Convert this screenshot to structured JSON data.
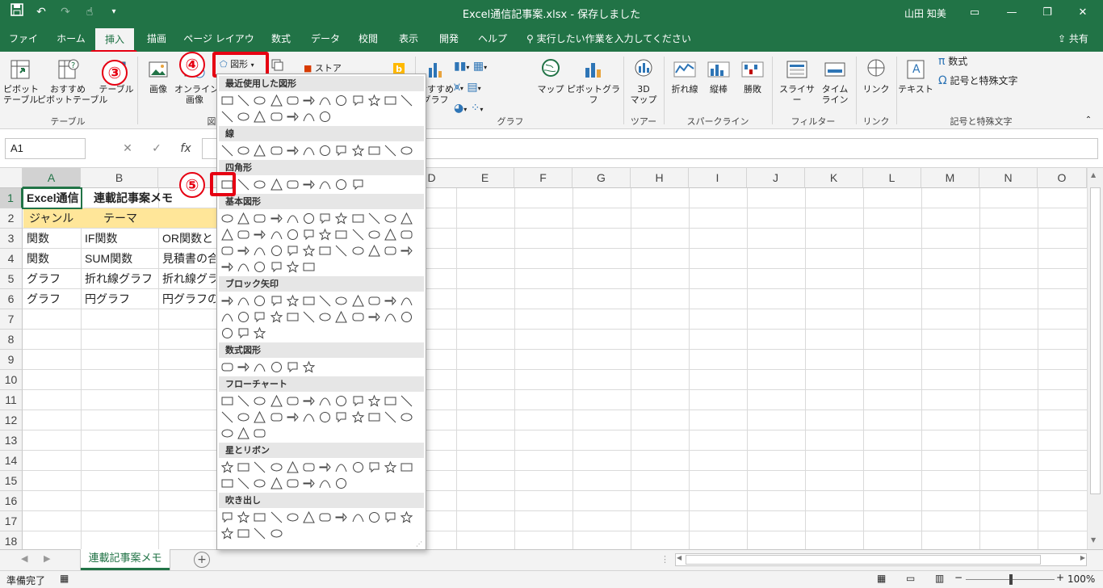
{
  "titlebar": {
    "title": "Excel通信記事案.xlsx  -  保存しました",
    "user": "山田 知美",
    "qat": {
      "save_icon": "floppy-disk-icon",
      "undo_icon": "undo-arrow-icon",
      "redo_icon": "redo-arrow-icon",
      "touch_icon": "hand-pointer-icon",
      "customize_icon": "chevron-down-icon"
    },
    "window_buttons": {
      "ribbon_display": "▭",
      "minimize": "—",
      "restore": "❐",
      "close": "✕"
    }
  },
  "tabs": [
    {
      "label": "ファイル"
    },
    {
      "label": "ホーム"
    },
    {
      "label": "挿入"
    },
    {
      "label": "描画"
    },
    {
      "label": "ページ レイアウト"
    },
    {
      "label": "数式"
    },
    {
      "label": "データ"
    },
    {
      "label": "校閲"
    },
    {
      "label": "表示"
    },
    {
      "label": "開発"
    },
    {
      "label": "ヘルプ"
    }
  ],
  "active_tab": "挿入",
  "tellme": "実行したい作業を入力してください",
  "share": "共有",
  "annotations": {
    "step3": "③",
    "step4": "④",
    "step5": "⑤"
  },
  "ribbon": {
    "pivot": "ピボット\nテーブル",
    "recommended_pivot": "おすすめ\nピボットテーブル",
    "table": "テーブル",
    "group_table": "テーブル",
    "picture": "画像",
    "online_picture": "オンライン\n画像",
    "group_illust": "図",
    "shapes_button": "図形",
    "store": "ストア",
    "recommended_chart": "おすすめ\nグラフ",
    "map": "マップ",
    "pivot_chart": "ピボットグラフ",
    "group_chart": "グラフ",
    "map3d": "3D\nマップ",
    "group_tour": "ツアー",
    "line": "折れ線",
    "column": "縦棒",
    "winloss": "勝敗",
    "group_sparkline": "スパークライン",
    "slicer": "スライサー",
    "timeline": "タイム\nライン",
    "group_filter": "フィルター",
    "link": "リンク",
    "group_link": "リンク",
    "text": "テキスト",
    "equation": "数式",
    "symbol": "記号と特殊文字",
    "group_symbol": "記号と特殊文字"
  },
  "formulabar": {
    "namebox": "A1",
    "cancel": "✕",
    "enter": "✓",
    "fx": "fx"
  },
  "grid": {
    "columns": [
      "A",
      "B",
      "C",
      "D",
      "E",
      "F",
      "G",
      "H",
      "I",
      "J",
      "K",
      "L",
      "M",
      "N",
      "O"
    ],
    "rows": [
      "1",
      "2",
      "3",
      "4",
      "5",
      "6",
      "7",
      "8",
      "9",
      "10",
      "11",
      "12",
      "13",
      "14",
      "15",
      "16",
      "17",
      "18"
    ],
    "cells": {
      "A1": "Excel通信",
      "B1": "連載記事案メモ",
      "A2": "ジャンル",
      "B2": "テーマ",
      "A3": "関数",
      "B3": "IF関数",
      "C3": "OR関数と",
      "A4": "関数",
      "B4": "SUM関数",
      "C4": "見積書の合",
      "A5": "グラフ",
      "B5": "折れ線グラフ",
      "C5": "折れ線グラ",
      "A6": "グラフ",
      "B6": "円グラフ",
      "C6": "円グラフの"
    }
  },
  "sheet": {
    "tab": "連載記事案メモ",
    "add": "+"
  },
  "statusbar": {
    "ready": "準備完了",
    "zoom": "100%"
  },
  "shapes_panel": {
    "sections": [
      {
        "title": "最近使用した図形"
      },
      {
        "title": "線"
      },
      {
        "title": "四角形"
      },
      {
        "title": "基本図形"
      },
      {
        "title": "ブロック矢印"
      },
      {
        "title": "数式図形"
      },
      {
        "title": "フローチャート"
      },
      {
        "title": "星とリボン"
      },
      {
        "title": "吹き出し"
      }
    ]
  },
  "colors": {
    "excel_green": "#217346",
    "highlight": "#e60012",
    "band": "#ffe699"
  }
}
